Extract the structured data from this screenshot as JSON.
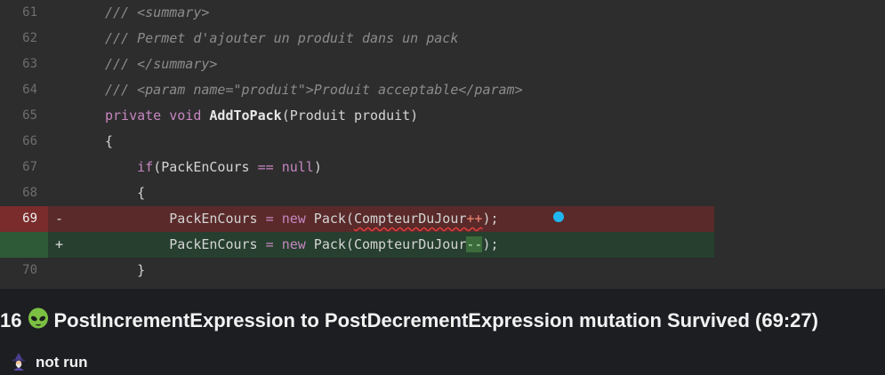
{
  "code": {
    "lines": [
      {
        "num": "61",
        "marker": "",
        "parts": [
          {
            "t": "/// <summary>",
            "c": "comment"
          }
        ]
      },
      {
        "num": "62",
        "marker": "",
        "parts": [
          {
            "t": "/// Permet d'ajouter un produit dans un pack",
            "c": "comment"
          }
        ]
      },
      {
        "num": "63",
        "marker": "",
        "parts": [
          {
            "t": "/// </summary>",
            "c": "comment"
          }
        ]
      },
      {
        "num": "64",
        "marker": "",
        "parts": [
          {
            "t": "/// <param name=\"produit\">Produit acceptable</param>",
            "c": "comment"
          }
        ]
      },
      {
        "num": "65",
        "marker": "",
        "parts": [
          {
            "t": "private",
            "c": "kw"
          },
          {
            "t": " ",
            "c": "plain"
          },
          {
            "t": "void",
            "c": "kw"
          },
          {
            "t": " ",
            "c": "plain"
          },
          {
            "t": "AddToPack",
            "c": "method"
          },
          {
            "t": "(Produit produit)",
            "c": "plain"
          }
        ]
      },
      {
        "num": "66",
        "marker": "",
        "parts": [
          {
            "t": "{",
            "c": "plain"
          }
        ]
      },
      {
        "num": "67",
        "marker": "",
        "parts": [
          {
            "t": "    ",
            "c": "plain"
          },
          {
            "t": "if",
            "c": "kw"
          },
          {
            "t": "(PackEnCours ",
            "c": "plain"
          },
          {
            "t": "==",
            "c": "kw"
          },
          {
            "t": " ",
            "c": "plain"
          },
          {
            "t": "null",
            "c": "kw"
          },
          {
            "t": ")",
            "c": "plain"
          }
        ]
      },
      {
        "num": "68",
        "marker": "",
        "parts": [
          {
            "t": "    {",
            "c": "plain"
          }
        ]
      },
      {
        "num": "69",
        "marker": "-",
        "kind": "removed",
        "parts": [
          {
            "t": "        PackEnCours ",
            "c": "plain"
          },
          {
            "t": "=",
            "c": "kw"
          },
          {
            "t": " ",
            "c": "plain"
          },
          {
            "t": "new",
            "c": "kw"
          },
          {
            "t": " Pack(",
            "c": "plain"
          },
          {
            "t": "CompteurDuJour",
            "c": "squiggle"
          },
          {
            "t": "++",
            "c": "op-removed squiggle"
          },
          {
            "t": ");",
            "c": "plain"
          }
        ]
      },
      {
        "num": "",
        "marker": "+",
        "kind": "added",
        "parts": [
          {
            "t": "        PackEnCours ",
            "c": "plain"
          },
          {
            "t": "=",
            "c": "kw"
          },
          {
            "t": " ",
            "c": "plain"
          },
          {
            "t": "new",
            "c": "kw"
          },
          {
            "t": " Pack(",
            "c": "plain"
          },
          {
            "t": "CompteurDuJour",
            "c": "plain"
          },
          {
            "t": "--",
            "c": "op-added"
          },
          {
            "t": ");",
            "c": "plain"
          }
        ]
      },
      {
        "num": "70",
        "marker": "",
        "parts": [
          {
            "t": "    }",
            "c": "plain"
          }
        ]
      }
    ]
  },
  "mutation": {
    "index": "16",
    "status_icon": "alien-icon",
    "title": "PostIncrementExpression to PostDecrementExpression mutation Survived (69:27)"
  },
  "status": {
    "icon": "wizard-icon",
    "text": "not run"
  },
  "colors": {
    "removed_line": "#5a2a2a",
    "removed_gutter": "#7a2b2b",
    "added_line": "#263f2e",
    "added_gutter": "#2f5a38",
    "breakpoint_dot": "#1fb6f0",
    "alien_green": "#7bc043"
  }
}
